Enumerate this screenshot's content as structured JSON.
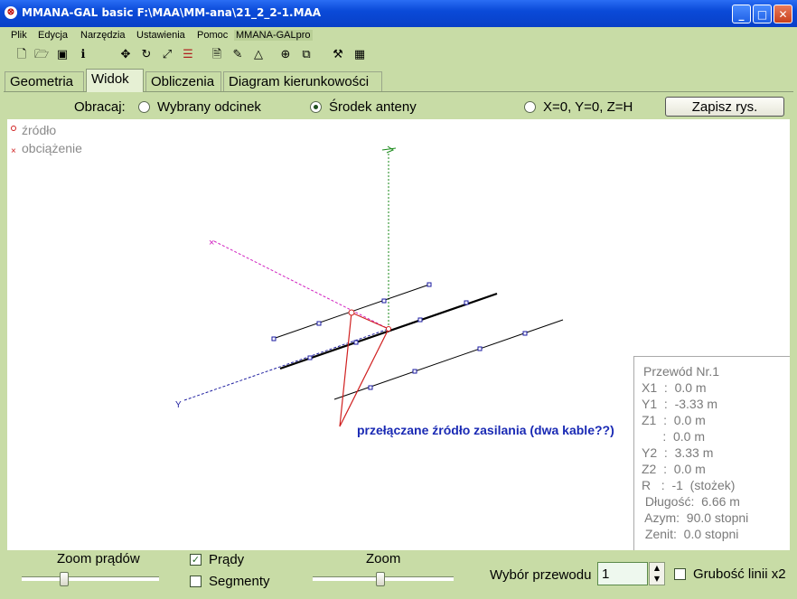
{
  "window": {
    "title": "MMANA-GAL basic F:\\MAA\\MM-ana\\21_2_2-1.MAA",
    "minimize": "_",
    "maximize": "□",
    "close": "✕"
  },
  "menu": [
    "Plik",
    "Edycja",
    "Narzędzia",
    "Ustawienia",
    "Pomoc",
    "MMANA-GALpro"
  ],
  "toolbar_icons": [
    "new-file-icon",
    "open-folder-icon",
    "save-icon",
    "info-icon",
    "move-icon",
    "rotate-icon",
    "zoom-icon",
    "list-icon",
    "page-icon",
    "eraser-icon",
    "triangle-icon",
    "target-icon",
    "copy-icon",
    "tools-icon",
    "calculator-icon"
  ],
  "tabs": [
    {
      "label": "Geometria",
      "active": false
    },
    {
      "label": "Widok",
      "active": true
    },
    {
      "label": "Obliczenia",
      "active": false
    },
    {
      "label": "Diagram kierunkowości",
      "active": false
    }
  ],
  "rotate": {
    "label": "Obracaj:",
    "options": [
      {
        "label": "Wybrany odcinek",
        "selected": false
      },
      {
        "label": "Środek anteny",
        "selected": true
      },
      {
        "label": "X=0, Y=0, Z=H",
        "selected": false
      }
    ],
    "save_button": "Zapisz rys."
  },
  "legend": {
    "source": "źródło",
    "load": "obciążenie"
  },
  "view": {
    "annotation": "przełączane źródło zasilania (dwa kable??)",
    "axis_y_label": "Y",
    "colors": {
      "source": "#d02020",
      "annotation": "#1a2ab4",
      "z_axis": "#1a8a1a",
      "x_axis": "#d020c0",
      "y_axis": "#2020a0"
    }
  },
  "info_panel": [
    "Przewód Nr.1",
    "X1  :  0.0 m",
    "Y1  :  -3.33 m",
    "Z1  :  0.0 m",
    "      :  0.0 m",
    "Y2  :  3.33 m",
    "Z2  :  0.0 m",
    "R   :  -1  (stożek)",
    " Długość:  6.66 m",
    " Azym:  90.0 stopni",
    " Zenit:  0.0 stopni"
  ],
  "bottom": {
    "zoom_currents_label": "Zoom prądów",
    "currents_label": "Prądy",
    "currents_checked": true,
    "segments_label": "Segmenty",
    "segments_checked": false,
    "zoom_label": "Zoom",
    "wire_select_label": "Wybór przewodu",
    "wire_value": "1",
    "thick_label": "Grubość linii x2",
    "thick_checked": false
  }
}
